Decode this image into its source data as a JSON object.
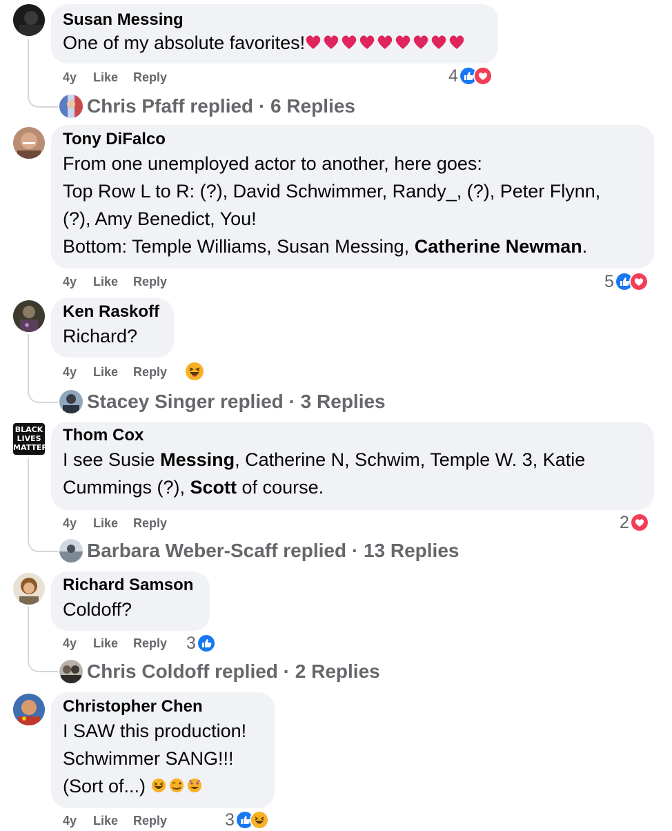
{
  "action_labels": {
    "time": "4y",
    "like": "Like",
    "reply": "Reply"
  },
  "comments": [
    {
      "author": "Susan Messing",
      "text": "One of my absolute favorites!",
      "reaction_count": "4",
      "replied": "Chris Pfaff replied · 6 Replies"
    },
    {
      "author": "Tony DiFalco",
      "lines": [
        "From one unemployed actor to another, here goes:",
        "Top Row L to R: (?), David Schwimmer, Randy_, (?), Peter Flynn,",
        "(?), Amy Benedict, You!"
      ],
      "last_prefix": "Bottom: Temple Williams, Susan Messing, ",
      "last_bold": "Catherine Newman",
      "last_suffix": ".",
      "reaction_count": "5"
    },
    {
      "author": "Ken Raskoff",
      "text": "Richard?",
      "replied": "Stacey Singer replied · 3 Replies"
    },
    {
      "author": "Thom Cox",
      "avatar_text": [
        "BLACK",
        "LIVES",
        "MATTER"
      ],
      "l1_a": "I see Susie ",
      "l1_b": "Messing",
      "l1_c": ", Catherine N, Schwim, Temple W. 3, Katie",
      "l2_a": "Cummings (?), ",
      "l2_b": "Scott",
      "l2_c": " of course.",
      "reaction_count": "2",
      "replied": "Barbara Weber-Scaff replied · 13 Replies"
    },
    {
      "author": "Richard Samson",
      "text": "Coldoff?",
      "reaction_count": "3",
      "replied": "Chris Coldoff replied · 2 Replies"
    },
    {
      "author": "Christopher Chen",
      "lines": [
        "I SAW this production!",
        "Schwimmer SANG!!!",
        "(Sort of...)"
      ],
      "reaction_count": "3"
    }
  ],
  "colors": {
    "like_blue": "#1877f2",
    "love_red": "#f33e58",
    "bubble": "#f0f2f5",
    "meta_grey": "#65676b"
  }
}
